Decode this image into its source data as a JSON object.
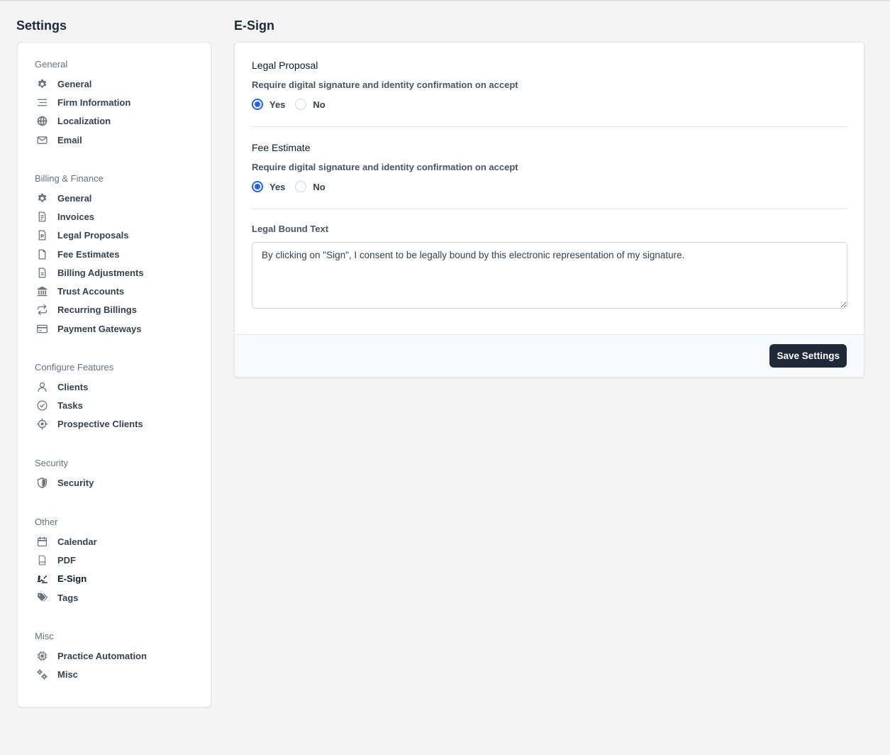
{
  "settings_title": "Settings",
  "content_title": "E-Sign",
  "sidebar": {
    "groups": [
      {
        "title": "General",
        "items": [
          {
            "label": "General",
            "icon": "gear-icon"
          },
          {
            "label": "Firm Information",
            "icon": "lines-icon"
          },
          {
            "label": "Localization",
            "icon": "globe-icon"
          },
          {
            "label": "Email",
            "icon": "envelope-icon"
          }
        ]
      },
      {
        "title": "Billing & Finance",
        "items": [
          {
            "label": "General",
            "icon": "gear-icon"
          },
          {
            "label": "Invoices",
            "icon": "invoice-icon"
          },
          {
            "label": "Legal Proposals",
            "icon": "proposal-icon"
          },
          {
            "label": "Fee Estimates",
            "icon": "file-icon"
          },
          {
            "label": "Billing Adjustments",
            "icon": "document-icon"
          },
          {
            "label": "Trust Accounts",
            "icon": "bank-icon"
          },
          {
            "label": "Recurring Billings",
            "icon": "repeat-icon"
          },
          {
            "label": "Payment Gateways",
            "icon": "credit-card-icon"
          }
        ]
      },
      {
        "title": "Configure Features",
        "items": [
          {
            "label": "Clients",
            "icon": "user-icon"
          },
          {
            "label": "Tasks",
            "icon": "check-circle-icon"
          },
          {
            "label": "Prospective Clients",
            "icon": "crosshair-icon"
          }
        ]
      },
      {
        "title": "Security",
        "items": [
          {
            "label": "Security",
            "icon": "shield-icon"
          }
        ]
      },
      {
        "title": "Other",
        "items": [
          {
            "label": "Calendar",
            "icon": "calendar-icon"
          },
          {
            "label": "PDF",
            "icon": "pdf-icon"
          },
          {
            "label": "E-Sign",
            "icon": "signature-icon",
            "active": true
          },
          {
            "label": "Tags",
            "icon": "tags-icon"
          }
        ]
      },
      {
        "title": "Misc",
        "items": [
          {
            "label": "Practice Automation",
            "icon": "chip-icon"
          },
          {
            "label": "Misc",
            "icon": "gears-icon"
          }
        ]
      }
    ]
  },
  "legal_proposal": {
    "title": "Legal Proposal",
    "question": "Require digital signature and identity confirmation on accept",
    "yes_label": "Yes",
    "no_label": "No",
    "selected": "yes"
  },
  "fee_estimate": {
    "title": "Fee Estimate",
    "question": "Require digital signature and identity confirmation on accept",
    "yes_label": "Yes",
    "no_label": "No",
    "selected": "yes"
  },
  "legal_bound": {
    "label": "Legal Bound Text",
    "value": "By clicking on \"Sign\", I consent to be legally bound by this electronic representation of my signature."
  },
  "footer": {
    "save_label": "Save Settings"
  },
  "colors": {
    "accent": "#2563eb",
    "button": "#1f2937"
  }
}
